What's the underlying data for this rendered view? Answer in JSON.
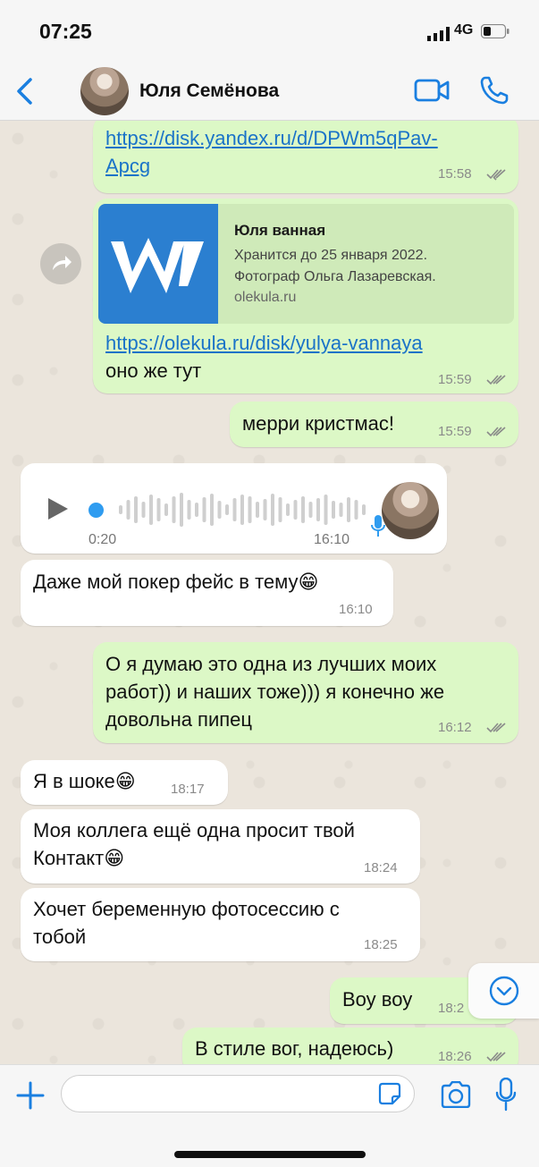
{
  "status_bar": {
    "time": "07:25",
    "network": "4G"
  },
  "header": {
    "contact_name": "Юля Семёнова"
  },
  "messages": [
    {
      "type": "out",
      "link": "https://disk.yandex.ru/d/DPWm5qPav-Apcg",
      "link_line1": "https://disk.yandex.ru/d/DPWm5qPav-",
      "link_line2": "Apcg",
      "time": "15:58"
    },
    {
      "type": "out",
      "preview": {
        "title": "Юля ванная",
        "description_line1": "Хранится до 25 января 2022.",
        "description_line2": "Фотограф Ольга Лазаревская.",
        "domain": "olekula.ru"
      },
      "link": "https://olekula.ru/disk/yulya-vannaya",
      "text": "оно же тут",
      "time": "15:59"
    },
    {
      "type": "out",
      "text": "мерри кристмас!",
      "time": "15:59"
    },
    {
      "type": "in_voice",
      "duration": "0:20",
      "time": "16:10"
    },
    {
      "type": "in",
      "text": "Даже мой покер фейс в тему😁",
      "time": "16:10"
    },
    {
      "type": "out",
      "line1": "О я думаю это одна из лучших моих",
      "line2": "работ)) и наших тоже))) я конечно же",
      "line3": "довольна пипец",
      "time": "16:12"
    },
    {
      "type": "in",
      "text": "Я в шоке😁",
      "time": "18:17"
    },
    {
      "type": "in",
      "line1": "Моя коллега ещё одна просит твой",
      "line2": "Контакт😁",
      "time": "18:24"
    },
    {
      "type": "in",
      "line1": "Хочет беременную фотосессию с",
      "line2": "тобой",
      "time": "18:25"
    },
    {
      "type": "out",
      "text": "Воу воу",
      "time": "18:2"
    },
    {
      "type": "out",
      "text": "В стиле вог, надеюсь)",
      "time": "18:26"
    }
  ],
  "input": {
    "placeholder": ""
  },
  "colors": {
    "outgoing": "#dcf8c6",
    "incoming": "#ffffff",
    "link": "#1a73c8",
    "accent": "#1a7fe0"
  }
}
